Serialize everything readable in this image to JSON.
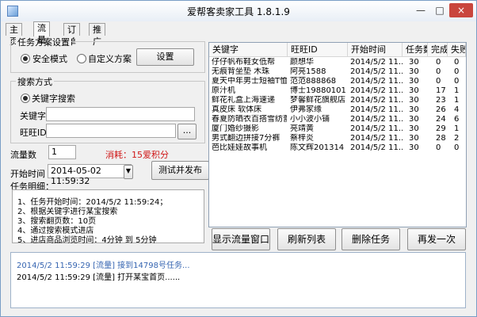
{
  "window": {
    "title": "爱帮客卖家工具 1.8.1.9",
    "minimize_label": "—",
    "maximize_label": "□",
    "close_label": "×"
  },
  "tabs": [
    {
      "label": "主页",
      "active": false
    },
    {
      "label": "流量",
      "active": true
    },
    {
      "label": "订单",
      "active": false
    },
    {
      "label": "推广",
      "active": false
    }
  ],
  "task_settings": {
    "title": "任务方案设置",
    "option_safe": "安全模式",
    "option_custom": "自定义方案",
    "selected": "安全模式",
    "settings_button": "设置"
  },
  "search_method": {
    "title": "搜索方式",
    "option_keyword": "关键字搜索",
    "keyword_label": "关键字",
    "keyword_value": "",
    "wangwang_label": "旺旺ID",
    "wangwang_value": "",
    "browse_button": "..."
  },
  "traffic": {
    "count_label": "流量数",
    "count_value": "1",
    "cost_text": "消耗：15爱积分",
    "start_time_label": "开始时间",
    "start_time_value": "2014-05-02 11:59:32",
    "test_publish_button": "测试并发布",
    "details_title": "任务明细：",
    "details": [
      "1、任务开始时间：2014/5/2 11:59:24；",
      "2、根据关键字进行某宝搜索",
      "3、搜索翻页数：10页",
      "4、通过搜索模式进店",
      "5、进店商品浏览时间：4分钟 到 5分钟"
    ]
  },
  "task_table": {
    "columns": [
      "关键字",
      "旺旺ID",
      "开始时间",
      "任务数",
      "完成",
      "失败"
    ],
    "rows": [
      [
        "仔仔帆布鞋女低帮",
        "颜想华",
        "2014/5/2 11...",
        "30",
        "0",
        "0"
      ],
      [
        "无痕背坐垫 木珠",
        "阿亮1588",
        "2014/5/2 11...",
        "30",
        "0",
        "0"
      ],
      [
        "夏天中年男士短袖T恤衫",
        "范范888868",
        "2014/5/2 11...",
        "30",
        "0",
        "0"
      ],
      [
        "原汁机",
        "博士19880101",
        "2014/5/2 11...",
        "30",
        "17",
        "1"
      ],
      [
        "鲜花礼盒上海速递",
        "梦馨鲜花旗舰店",
        "2014/5/2 11...",
        "30",
        "23",
        "1"
      ],
      [
        "真皮床 软体床",
        "伊弗家缘",
        "2014/5/2 11...",
        "30",
        "26",
        "4"
      ],
      [
        "春夏防晒衣百搭雪纺蕾...",
        "小小波小铺",
        "2014/5/2 11...",
        "30",
        "24",
        "6"
      ],
      [
        "厦门婚纱摄影",
        "亮靖黄",
        "2014/5/2 11...",
        "30",
        "29",
        "1"
      ],
      [
        "男式翻边拼接7分裤",
        "蔡梓炎",
        "2014/5/2 11...",
        "30",
        "28",
        "2"
      ],
      [
        "芭比娃娃故事机",
        "陈文辉201314",
        "2014/5/2 11...",
        "30",
        "0",
        "0"
      ]
    ]
  },
  "actions": {
    "show_window": "显示流量窗口",
    "refresh_list": "刷新列表",
    "delete_task": "删除任务",
    "resend_once": "再发一次"
  },
  "log": {
    "lines": [
      "2014/5/2 11:59:29 [流量] 接到14798号任务...",
      "2014/5/2 11:59:29 [流量] 打开某宝首页......"
    ]
  },
  "colors": {
    "accent_blue": "#3665b1",
    "cost_red": "#d01818"
  }
}
